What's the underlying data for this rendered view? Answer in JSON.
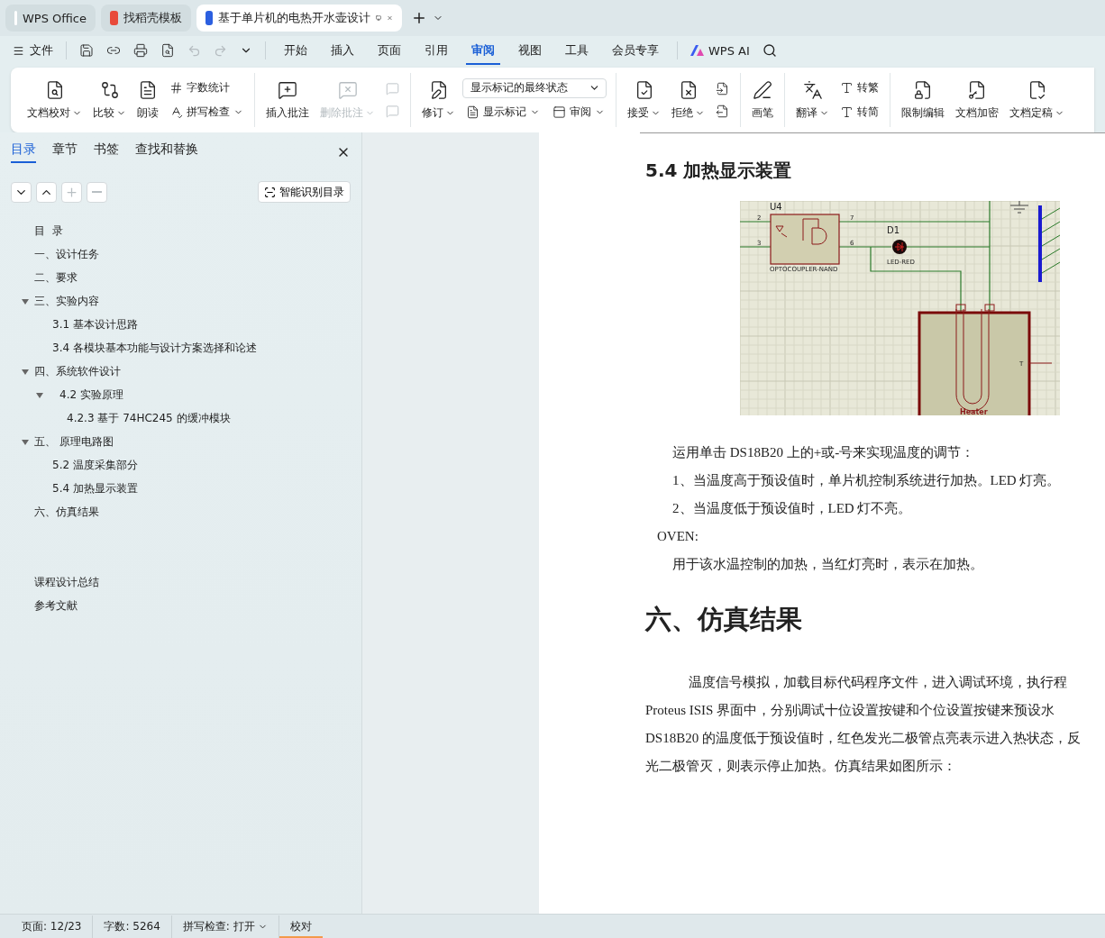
{
  "app_tabs": [
    {
      "label": "WPS Office",
      "kind": "home",
      "selected": false
    },
    {
      "label": "找稻壳模板",
      "kind": "template",
      "selected": false
    },
    {
      "label": "基于单片机的电热开水壶设计",
      "kind": "document",
      "selected": true
    }
  ],
  "menu": {
    "file": "文件",
    "tabs": [
      {
        "label": "开始",
        "selected": false
      },
      {
        "label": "插入",
        "selected": false
      },
      {
        "label": "页面",
        "selected": false
      },
      {
        "label": "引用",
        "selected": false
      },
      {
        "label": "审阅",
        "selected": true
      },
      {
        "label": "视图",
        "selected": false
      },
      {
        "label": "工具",
        "selected": false
      },
      {
        "label": "会员专享",
        "selected": false
      }
    ],
    "ai": "WPS AI"
  },
  "ribbon": [
    {
      "items": [
        {
          "kind": "large",
          "label": "文档校对",
          "caret": true,
          "disabled": false
        },
        {
          "kind": "large",
          "label": "比较",
          "caret": true,
          "disabled": false
        },
        {
          "kind": "large",
          "label": "朗读",
          "caret": false,
          "disabled": false
        },
        {
          "kind": "stack",
          "rows": [
            {
              "label": "字数统计",
              "caret": false,
              "disabled": false
            },
            {
              "label": "拼写检查",
              "caret": true,
              "disabled": false
            }
          ]
        }
      ]
    },
    {
      "items": [
        {
          "kind": "large",
          "label": "插入批注",
          "caret": false,
          "disabled": false
        },
        {
          "kind": "large",
          "label": "删除批注",
          "caret": true,
          "disabled": true
        },
        {
          "kind": "stack",
          "rows": [
            {
              "caret": false,
              "disabled": true
            },
            {
              "caret": false,
              "disabled": true
            }
          ]
        }
      ]
    },
    {
      "items": [
        {
          "kind": "large",
          "label": "修订",
          "caret": true,
          "disabled": false
        },
        {
          "kind": "combo",
          "select": "显示标记的最终状态",
          "rows": [
            {
              "label": "显示标记",
              "caret": true,
              "disabled": false
            },
            {
              "label": "审阅",
              "caret": true,
              "disabled": false
            }
          ]
        }
      ]
    },
    {
      "items": [
        {
          "kind": "large",
          "label": "接受",
          "caret": true,
          "disabled": false
        },
        {
          "kind": "large",
          "label": "拒绝",
          "caret": true,
          "disabled": false
        },
        {
          "kind": "stack",
          "rows": [
            {
              "caret": false,
              "disabled": false
            },
            {
              "caret": false,
              "disabled": false
            }
          ]
        }
      ]
    },
    {
      "items": [
        {
          "kind": "large",
          "label": "画笔",
          "caret": false,
          "disabled": false
        }
      ]
    },
    {
      "items": [
        {
          "kind": "large",
          "label": "翻译",
          "caret": true,
          "disabled": false
        },
        {
          "kind": "stack",
          "rows": [
            {
              "label": "转繁",
              "caret": false,
              "disabled": false
            },
            {
              "label": "转简",
              "caret": false,
              "disabled": false
            }
          ]
        }
      ]
    },
    {
      "items": [
        {
          "kind": "large",
          "label": "限制编辑",
          "caret": false,
          "disabled": false
        },
        {
          "kind": "large",
          "label": "文档加密",
          "caret": false,
          "disabled": false
        },
        {
          "kind": "large",
          "label": "文档定稿",
          "caret": true,
          "disabled": false
        }
      ]
    }
  ],
  "sidebar": {
    "tabs": [
      {
        "label": "目录",
        "selected": true
      },
      {
        "label": "章节",
        "selected": false
      },
      {
        "label": "书签",
        "selected": false
      },
      {
        "label": "查找和替换",
        "selected": false
      }
    ],
    "tools": [
      {
        "disabled": false
      },
      {
        "disabled": false
      },
      {
        "disabled": true
      },
      {
        "disabled": true
      }
    ],
    "smart_button": "智能识别目录",
    "toc": [
      {
        "label": "目  录"
      },
      {
        "label": "一、设计任务"
      },
      {
        "label": "二、要求"
      },
      {
        "label": "三、实验内容",
        "expanded": true,
        "children": [
          {
            "label": "3.1 基本设计思路"
          },
          {
            "label": "3.4 各模块基本功能与设计方案选择和论述"
          }
        ]
      },
      {
        "label": "四、系统软件设计",
        "expanded": true,
        "children": [
          {
            "label": "4.2 实验原理",
            "expanded": true,
            "children": [
              {
                "label": "4.2.3 基于 74HC245 的缓冲模块"
              }
            ]
          }
        ]
      },
      {
        "label": "五、 原理电路图",
        "expanded": true,
        "children": [
          {
            "label": "5.2 温度采集部分"
          },
          {
            "label": "5.4 加热显示装置"
          }
        ]
      },
      {
        "label": "六、仿真结果"
      }
    ],
    "back_matter": [
      {
        "label": "课程设计总结"
      },
      {
        "label": "参考文献"
      }
    ]
  },
  "document": {
    "blocks": [
      {
        "kind": "heading2",
        "text": "5.4 加热显示装置"
      },
      {
        "kind": "figure",
        "labels": {
          "u4": "U4",
          "pin2": "2",
          "pin3": "3",
          "pin7": "7",
          "pin6": "6",
          "d1": "D1",
          "led": "LED-RED",
          "part": "OPTOCOUPLER-NAND",
          "t": "T",
          "heater": "Heater"
        }
      },
      {
        "kind": "para",
        "text": "运用单击 DS18B20 上的+或-号来实现温度的调节："
      },
      {
        "kind": "para",
        "text": "1、当温度高于预设值时，单片机控制系统进行加热。LED 灯亮。"
      },
      {
        "kind": "para",
        "text": "2、当温度低于预设值时，LED 灯不亮。"
      },
      {
        "kind": "label",
        "text": "OVEN:"
      },
      {
        "kind": "para",
        "text": "用于该水温控制的加热，当红灯亮时，表示在加热。"
      },
      {
        "kind": "heading1",
        "text": "六、仿真结果"
      },
      {
        "kind": "body",
        "lines": [
          "温度信号模拟，加载目标代码程序文件，进入调试环境，执行程",
          "Proteus ISIS 界面中，分别调试十位设置按键和个位设置按键来预设水",
          "DS18B20 的温度低于预设值时，红色发光二极管点亮表示进入热状态，反",
          "光二极管灭，则表示停止加热。仿真结果如图所示："
        ]
      }
    ]
  },
  "status_bar": [
    {
      "label": "页面: 12/23",
      "caret": false,
      "selected": false
    },
    {
      "label": "字数: 5264",
      "caret": false,
      "selected": false
    },
    {
      "label": "拼写检查: 打开",
      "caret": true,
      "selected": false
    },
    {
      "label": "校对",
      "caret": false,
      "selected": true
    }
  ]
}
